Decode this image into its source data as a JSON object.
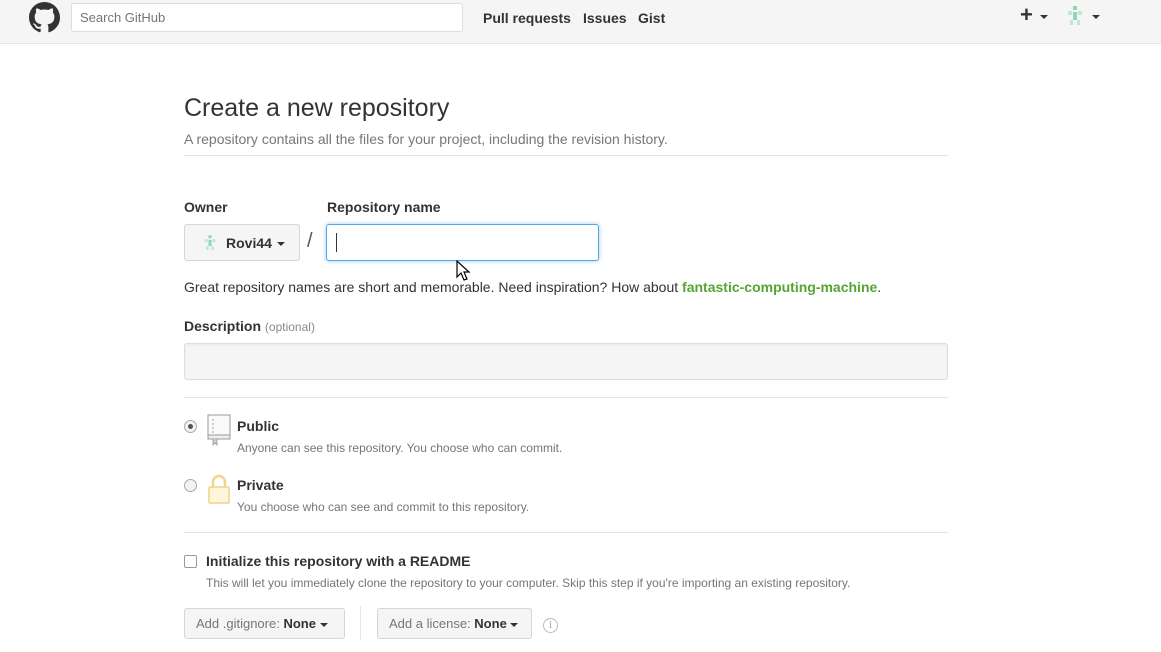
{
  "header": {
    "search_placeholder": "Search GitHub",
    "nav": [
      "Pull requests",
      "Issues",
      "Gist"
    ],
    "plus_label": "+"
  },
  "page": {
    "title": "Create a new repository",
    "subtitle": "A repository contains all the files for your project, including the revision history."
  },
  "form": {
    "owner_label": "Owner",
    "owner_value": "Rovi44",
    "repo_label": "Repository name",
    "repo_value": "",
    "slash": "/",
    "hint_text": "Great repository names are short and memorable. Need inspiration? How about ",
    "hint_suggestion": "fantastic-computing-machine",
    "hint_end": ".",
    "description_label": "Description",
    "description_optional": "(optional)",
    "description_value": ""
  },
  "visibility": {
    "selected": "public",
    "public_title": "Public",
    "public_desc": "Anyone can see this repository. You choose who can commit.",
    "private_title": "Private",
    "private_desc": "You choose who can see and commit to this repository."
  },
  "init": {
    "readme_label": "Initialize this repository with a README",
    "readme_desc": "This will let you immediately clone the repository to your computer. Skip this step if you're importing an existing repository.",
    "readme_checked": false,
    "gitignore_label": "Add .gitignore:",
    "gitignore_value": "None",
    "license_label": "Add a license:",
    "license_value": "None",
    "info_glyph": "i"
  },
  "colors": {
    "link_green": "#55a532",
    "focus_blue": "#51a7e8",
    "header_bg": "#f5f5f5"
  },
  "icons": [
    "github-logo-icon",
    "plus-icon",
    "avatar-icon",
    "repo-icon",
    "lock-icon",
    "info-icon",
    "caret-down-icon",
    "mouse-pointer-icon"
  ]
}
